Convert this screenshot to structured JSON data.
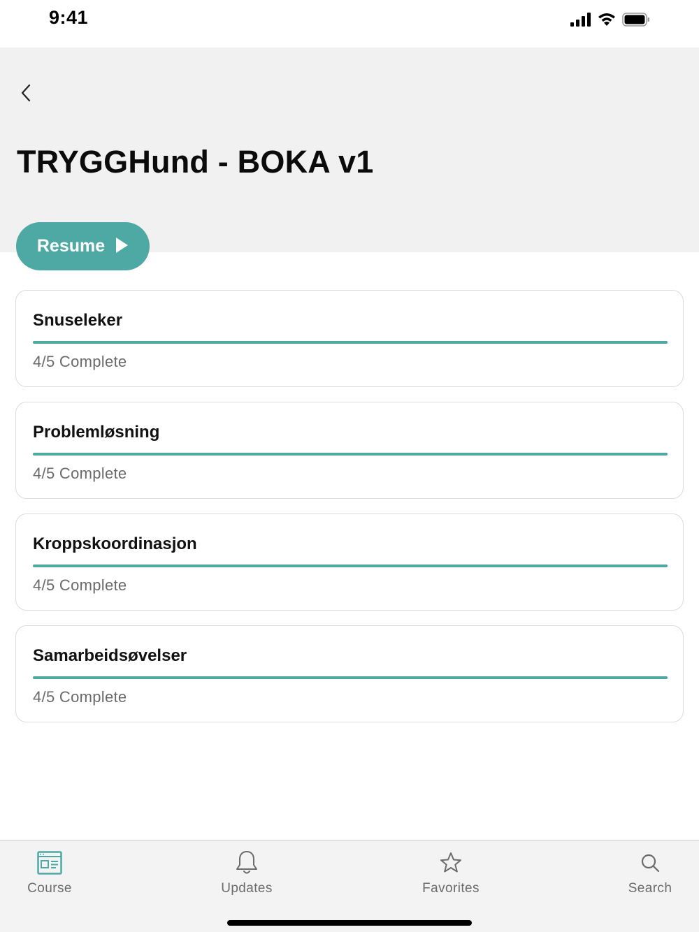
{
  "status_bar": {
    "time": "9:41",
    "icons": [
      "signal-icon",
      "wifi-icon",
      "battery-icon"
    ]
  },
  "header": {
    "back_icon": "chevron-left-icon",
    "title": "TRYGGHund - BOKA v1"
  },
  "resume": {
    "label": "Resume",
    "icon": "play-icon"
  },
  "modules": [
    {
      "title": "Snuseleker",
      "status": "4/5 Complete",
      "progress": 1.0
    },
    {
      "title": "Problemløsning",
      "status": "4/5 Complete",
      "progress": 1.0
    },
    {
      "title": "Kroppskoordinasjon",
      "status": "4/5 Complete",
      "progress": 1.0
    },
    {
      "title": "Samarbeidsøvelser",
      "status": "4/5 Complete",
      "progress": 1.0
    }
  ],
  "tab_bar": {
    "items": [
      {
        "label": "Course",
        "icon": "course-icon",
        "active": true
      },
      {
        "label": "Updates",
        "icon": "bell-icon",
        "active": false
      },
      {
        "label": "Favorites",
        "icon": "star-icon",
        "active": false
      },
      {
        "label": "Search",
        "icon": "search-icon",
        "active": false
      }
    ]
  },
  "colors": {
    "accent": "#4ea8a3",
    "header_bg": "#f1f1f1",
    "card_border": "#dcdcdc",
    "muted_text": "#6a6a6a"
  }
}
